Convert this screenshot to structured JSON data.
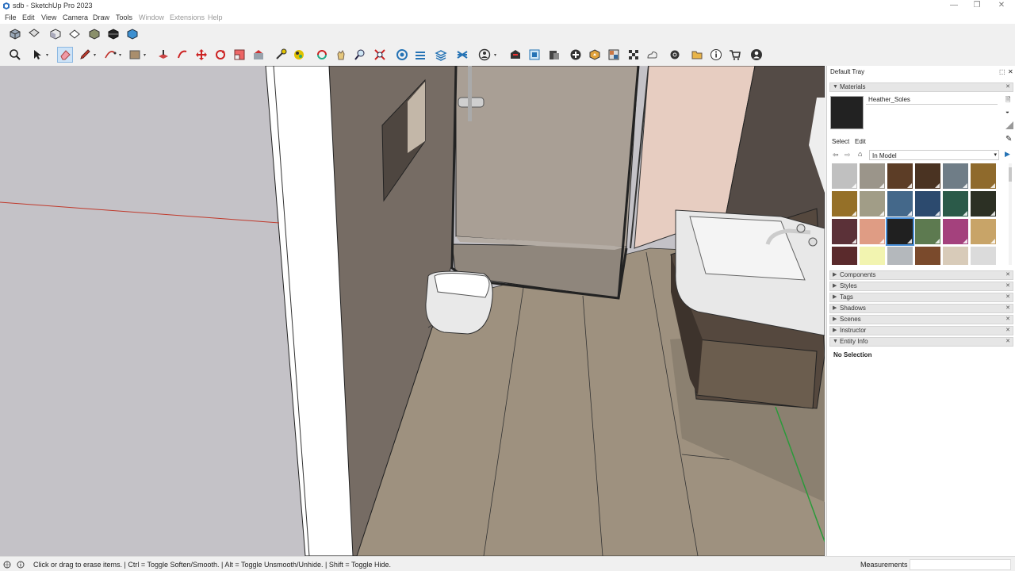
{
  "window": {
    "title": "sdb - SketchUp Pro 2023",
    "controls": [
      "minimize-icon",
      "restore-icon",
      "close-icon"
    ]
  },
  "menu": [
    "File",
    "Edit",
    "View",
    "Camera",
    "Draw",
    "Tools",
    "Window",
    "Extensions",
    "Help"
  ],
  "toolbar_views": [
    "iso-view-icon",
    "top-view-icon",
    "front-view-icon",
    "right-view-icon",
    "back-view-icon",
    "bottom-view-icon",
    "left-view-icon"
  ],
  "toolbar_main": {
    "active_tool": "eraser",
    "tools": [
      "search-icon",
      "select-icon",
      "eraser-icon",
      "pencil-icon",
      "arc-icon",
      "rectangle-icon",
      "push-pull-icon",
      "offset-icon",
      "move-icon",
      "rotate-icon",
      "scale-icon",
      "follow-me-icon",
      "tape-measure-icon",
      "paint-bucket-icon",
      "orbit-icon",
      "pan-icon",
      "zoom-icon",
      "zoom-extents-icon",
      "section-plane-icon",
      "sandbox-icon",
      "layers-icon",
      "solid-tools-icon",
      "account-icon",
      "warehouse-icon",
      "extension-warehouse-icon",
      "layout-icon",
      "add-location-icon",
      "geo-icon",
      "textures-icon",
      "style-builder-icon",
      "photo-texture-icon",
      "trimble-connect-icon",
      "preferences-icon",
      "folder-icon",
      "info-icon",
      "cart-icon",
      "user-icon"
    ]
  },
  "tray": {
    "title": "Default Tray",
    "materials": {
      "header": "Materials",
      "current_name": "Heather_Soles",
      "current_color": "#222222",
      "tabs": [
        "Select",
        "Edit"
      ],
      "library": "In Model",
      "swatches": [
        "#c0c0c0",
        "#9b958a",
        "#5c3d26",
        "#4a3322",
        "#6f7d87",
        "#8f6a2c",
        "#957028",
        "#a19d87",
        "#44688a",
        "#2c4a6e",
        "#2b5a49",
        "#2c3024",
        "#5b3138",
        "#df9c84",
        "#202020",
        "#5d7a50",
        "#a4417d",
        "#c8a468",
        "#5a2a2c",
        "#f2f4b0",
        "#b4b8bc",
        "#7a4a2c",
        "#d8cbb9",
        "#dbdbdb"
      ],
      "selected_index": 14
    },
    "panels": [
      "Components",
      "Styles",
      "Tags",
      "Shadows",
      "Scenes",
      "Instructor",
      "Entity Info"
    ],
    "entity_info": "No Selection"
  },
  "status": {
    "message": "Click or drag to erase items. | Ctrl = Toggle Soften/Smooth. | Alt = Toggle Unsmooth/Unhide. | Shift = Toggle Hide.",
    "measurements_label": "Measurements",
    "measurements_value": ""
  }
}
